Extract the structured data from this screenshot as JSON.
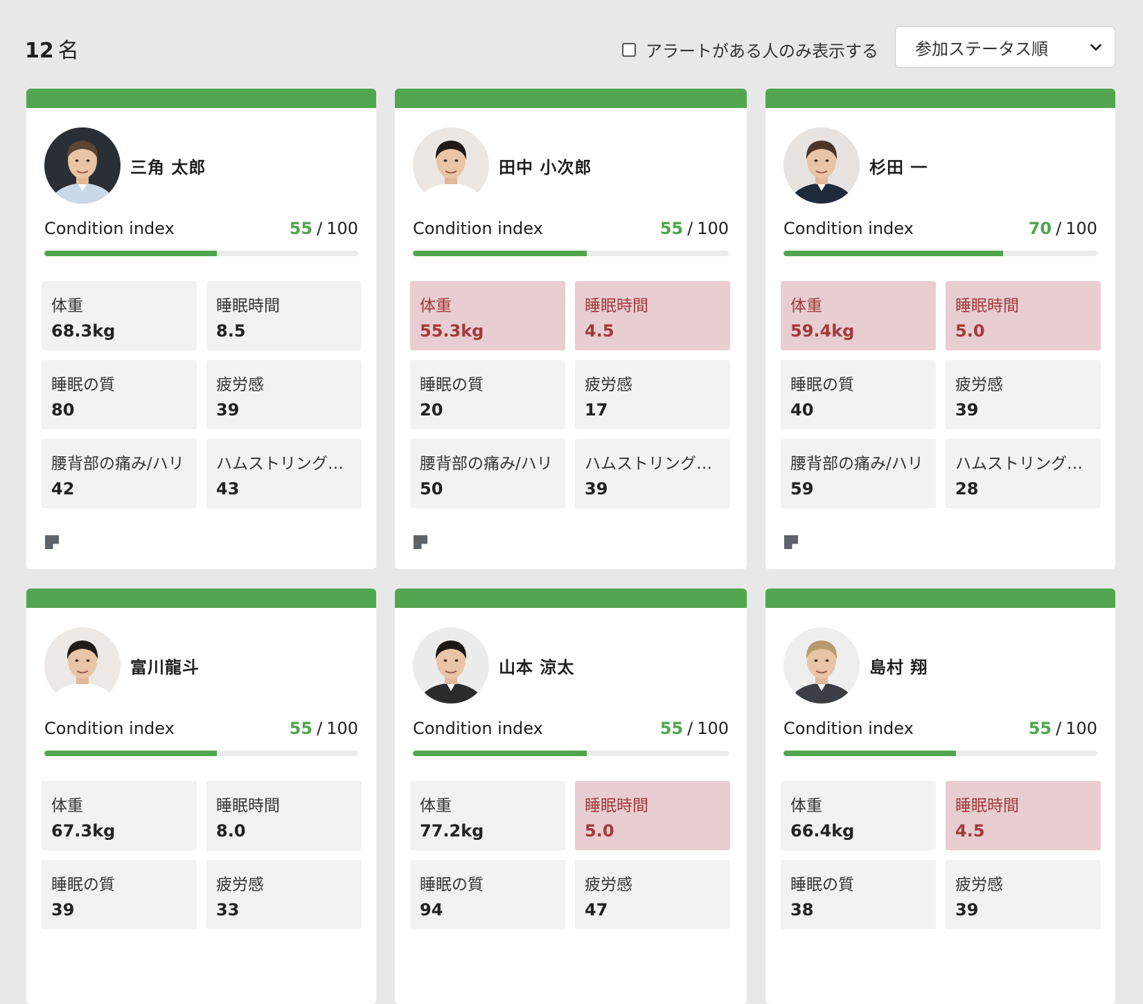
{
  "header": {
    "count": "12",
    "count_unit": "名",
    "alert_filter_label": "アラートがある人のみ表示する",
    "alert_filter_checked": false,
    "sort_selected": "参加ステータス順"
  },
  "colors": {
    "accent_green": "#53a650",
    "alert_bg": "#e8cdd1",
    "alert_text": "#a23a3a"
  },
  "ci_label": "Condition index",
  "ci_max": "100",
  "players": [
    {
      "name": "三角 太郎",
      "ci": "55",
      "ci_progress": 0.55,
      "metrics": [
        {
          "label": "体重",
          "value": "68.3kg",
          "alert": false
        },
        {
          "label": "睡眠時間",
          "value": "8.5",
          "alert": false
        },
        {
          "label": "睡眠の質",
          "value": "80",
          "alert": false
        },
        {
          "label": "疲労感",
          "value": "39",
          "alert": false
        },
        {
          "label": "腰背部の痛み/ハリ",
          "value": "42",
          "alert": false
        },
        {
          "label": "ハムストリング…",
          "value": "43",
          "alert": false
        }
      ]
    },
    {
      "name": "田中 小次郎",
      "ci": "55",
      "ci_progress": 0.55,
      "metrics": [
        {
          "label": "体重",
          "value": "55.3kg",
          "alert": true
        },
        {
          "label": "睡眠時間",
          "value": "4.5",
          "alert": true
        },
        {
          "label": "睡眠の質",
          "value": "20",
          "alert": false
        },
        {
          "label": "疲労感",
          "value": "17",
          "alert": false
        },
        {
          "label": "腰背部の痛み/ハリ",
          "value": "50",
          "alert": false
        },
        {
          "label": "ハムストリング…",
          "value": "39",
          "alert": false
        }
      ]
    },
    {
      "name": "杉田 一",
      "ci": "70",
      "ci_progress": 0.7,
      "metrics": [
        {
          "label": "体重",
          "value": "59.4kg",
          "alert": true
        },
        {
          "label": "睡眠時間",
          "value": "5.0",
          "alert": true
        },
        {
          "label": "睡眠の質",
          "value": "40",
          "alert": false
        },
        {
          "label": "疲労感",
          "value": "39",
          "alert": false
        },
        {
          "label": "腰背部の痛み/ハリ",
          "value": "59",
          "alert": false
        },
        {
          "label": "ハムストリング…",
          "value": "28",
          "alert": false
        }
      ]
    },
    {
      "name": "富川龍斗",
      "ci": "55",
      "ci_progress": 0.55,
      "metrics": [
        {
          "label": "体重",
          "value": "67.3kg",
          "alert": false
        },
        {
          "label": "睡眠時間",
          "value": "8.0",
          "alert": false
        },
        {
          "label": "睡眠の質",
          "value": "39",
          "alert": false
        },
        {
          "label": "疲労感",
          "value": "33",
          "alert": false
        }
      ]
    },
    {
      "name": "山本 涼太",
      "ci": "55",
      "ci_progress": 0.55,
      "metrics": [
        {
          "label": "体重",
          "value": "77.2kg",
          "alert": false
        },
        {
          "label": "睡眠時間",
          "value": "5.0",
          "alert": true
        },
        {
          "label": "睡眠の質",
          "value": "94",
          "alert": false
        },
        {
          "label": "疲労感",
          "value": "47",
          "alert": false
        }
      ]
    },
    {
      "name": "島村 翔",
      "ci": "55",
      "ci_progress": 0.55,
      "metrics": [
        {
          "label": "体重",
          "value": "66.4kg",
          "alert": false
        },
        {
          "label": "睡眠時間",
          "value": "4.5",
          "alert": true
        },
        {
          "label": "睡眠の質",
          "value": "38",
          "alert": false
        },
        {
          "label": "疲労感",
          "value": "39",
          "alert": false
        }
      ]
    }
  ]
}
